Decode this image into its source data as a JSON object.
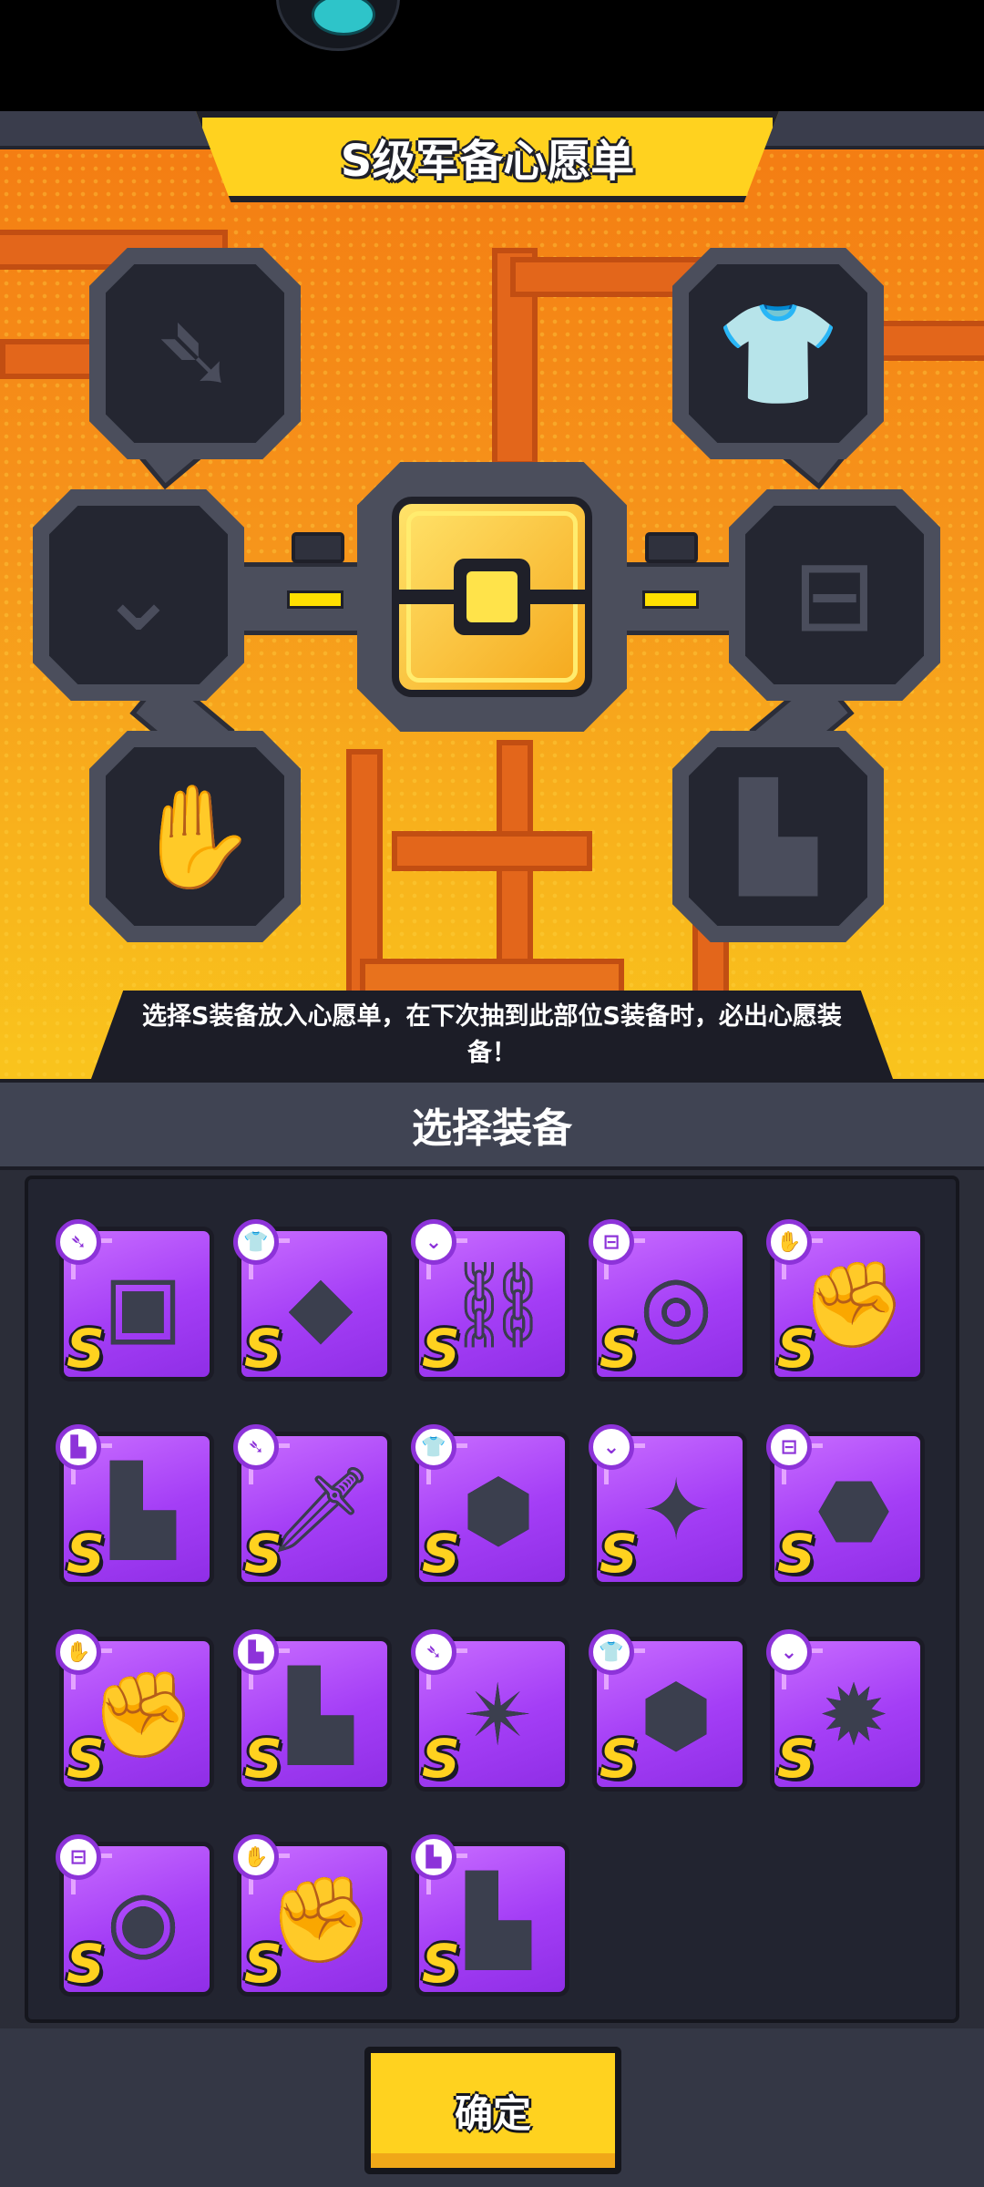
{
  "screen_title": "S级军备心愿单",
  "notice": "选择S装备放入心愿单，在下次抽到此部位S装备时，必出心愿装备！",
  "section_title": "选择装备",
  "confirm_label": "确定",
  "wish_slots": [
    {
      "icon": "weapon-slot-icon",
      "glyph": "➴"
    },
    {
      "icon": "armor-slot-icon",
      "glyph": "👕"
    },
    {
      "icon": "necklace-slot-icon",
      "glyph": "⌄"
    },
    {
      "icon": "belt-slot-icon",
      "glyph": "⊟"
    },
    {
      "icon": "glove-slot-icon",
      "glyph": "✋"
    },
    {
      "icon": "boots-slot-icon",
      "glyph": "▙"
    }
  ],
  "colors": {
    "rank_gold": "#ffd21f",
    "card_purple": "#a43ef6",
    "panel_orange": "#f6951b"
  },
  "equipment": [
    {
      "slot": "weapon",
      "badge": "➴",
      "art": "▣",
      "rank": "S"
    },
    {
      "slot": "armor",
      "badge": "👕",
      "art": "◆",
      "rank": "S"
    },
    {
      "slot": "necklace",
      "badge": "⌄",
      "art": "⛓",
      "rank": "S"
    },
    {
      "slot": "belt",
      "badge": "⊟",
      "art": "◎",
      "rank": "S"
    },
    {
      "slot": "glove",
      "badge": "✋",
      "art": "✊",
      "rank": "S"
    },
    {
      "slot": "boots",
      "badge": "▙",
      "art": "▙",
      "rank": "S"
    },
    {
      "slot": "weapon",
      "badge": "➴",
      "art": "🗡",
      "rank": "S"
    },
    {
      "slot": "armor",
      "badge": "👕",
      "art": "⬢",
      "rank": "S"
    },
    {
      "slot": "necklace",
      "badge": "⌄",
      "art": "✦",
      "rank": "S"
    },
    {
      "slot": "belt",
      "badge": "⊟",
      "art": "⬣",
      "rank": "S"
    },
    {
      "slot": "glove",
      "badge": "✋",
      "art": "✊",
      "rank": "S"
    },
    {
      "slot": "boots",
      "badge": "▙",
      "art": "▙",
      "rank": "S"
    },
    {
      "slot": "weapon",
      "badge": "➴",
      "art": "✴",
      "rank": "S"
    },
    {
      "slot": "armor",
      "badge": "👕",
      "art": "⬢",
      "rank": "S"
    },
    {
      "slot": "necklace",
      "badge": "⌄",
      "art": "✹",
      "rank": "S"
    },
    {
      "slot": "belt",
      "badge": "⊟",
      "art": "◉",
      "rank": "S"
    },
    {
      "slot": "glove",
      "badge": "✋",
      "art": "✊",
      "rank": "S"
    },
    {
      "slot": "boots",
      "badge": "▙",
      "art": "▙",
      "rank": "S"
    }
  ]
}
